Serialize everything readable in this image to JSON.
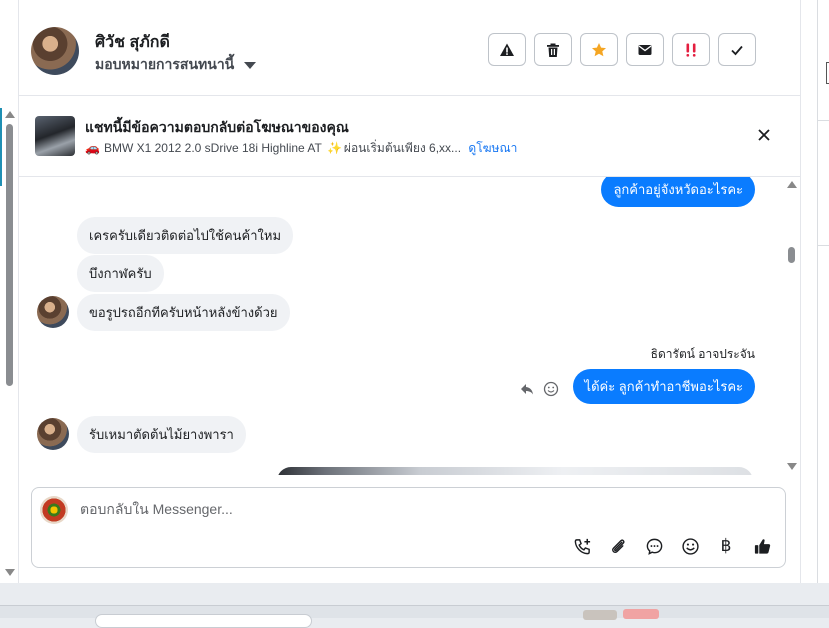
{
  "contact": {
    "name": "ศิวัช สุภักดี",
    "assign_label": "มอบหมายการสนทนานี้"
  },
  "actions": [
    {
      "name": "report-spam",
      "icon": "warning-icon"
    },
    {
      "name": "delete",
      "icon": "trash-icon"
    },
    {
      "name": "star",
      "icon": "star-icon",
      "color": "#f5a623"
    },
    {
      "name": "mark-unread",
      "icon": "envelope-icon"
    },
    {
      "name": "follow-up",
      "icon": "double-exclamation-icon",
      "color": "#e41e3f"
    },
    {
      "name": "mark-done",
      "icon": "check-icon"
    }
  ],
  "ad_banner": {
    "title": "แชทนี้มีข้อความตอบกลับต่อโฆษณาของคุณ",
    "car_emoji": "🚗",
    "subtitle": "BMW X1 2012 2.0 sDrive 18i Highline AT",
    "sparkle": "✨",
    "subtitle_tail": "ผ่อนเริ่มต้นเพียง 6,xx...",
    "link": "ดูโฆษณา"
  },
  "messages": [
    {
      "side": "right",
      "text": "ลูกค้าอยู่จังหวัดอะไรคะ"
    },
    {
      "side": "left",
      "text": "เครครับเดียวติดต่อไปใช้คนค้าใหม"
    },
    {
      "side": "left",
      "text": "บึงกาฬครับ"
    },
    {
      "side": "left",
      "text": "ขอรูปรถอีกทีครับหน้าหลังข้างด้วย"
    },
    {
      "side": "right",
      "sender": "ธิดารัตน์ อาจประจัน",
      "text": "ได้ค่ะ ลูกค้าทำอาชีพอะไรคะ"
    },
    {
      "side": "left",
      "text": "รับเหมาตัดต้นไม้ยางพารา"
    }
  ],
  "composer": {
    "placeholder": "ตอบกลับใน Messenger...",
    "tools": [
      "add-call-icon",
      "paperclip-icon",
      "chat-bubble-icon",
      "emoji-icon",
      "baht-icon",
      "thumbs-up-icon"
    ],
    "baht_symbol": "฿"
  },
  "colors": {
    "accent": "#0a7cff",
    "link": "#1877f2"
  }
}
